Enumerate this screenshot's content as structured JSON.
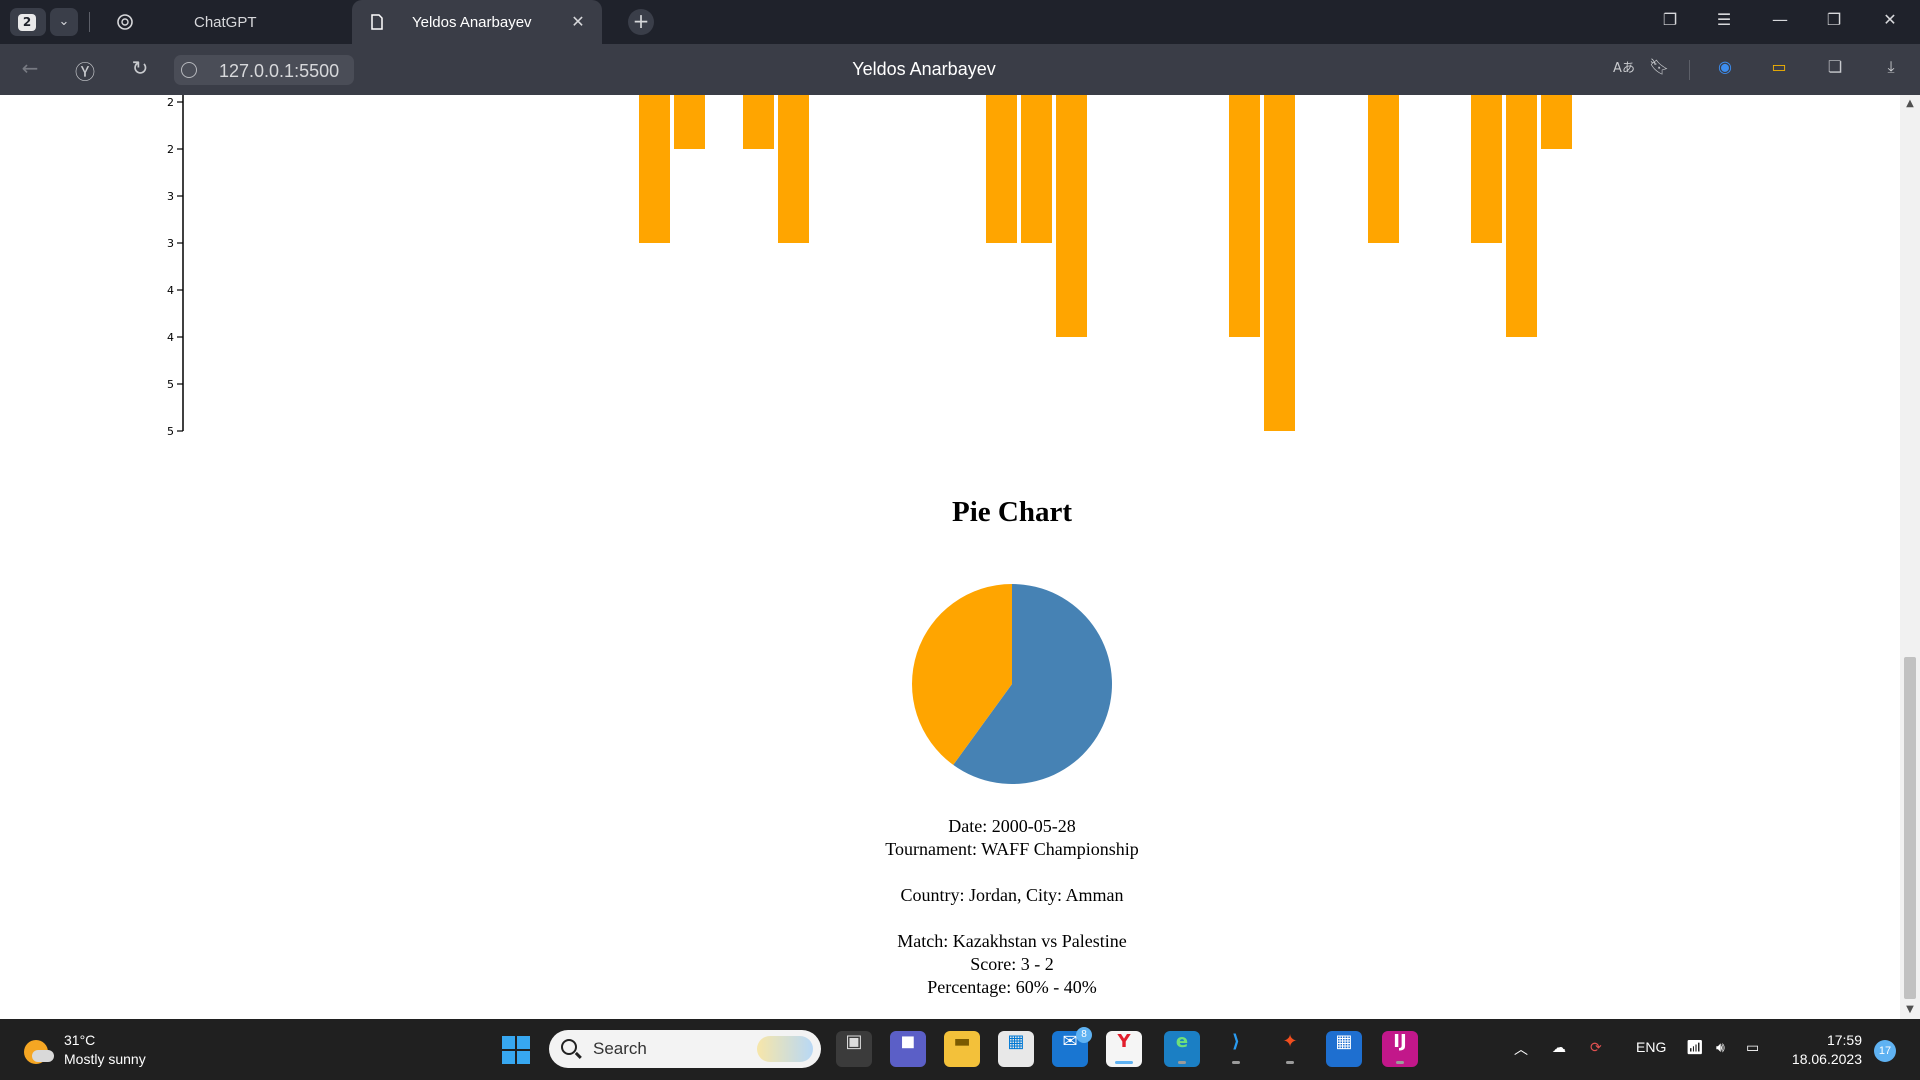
{
  "browser": {
    "tab_count": "2",
    "tabs": [
      {
        "label": "ChatGPT",
        "icon": "chatgpt-icon"
      },
      {
        "label": "Yeldos Anarbayev",
        "icon": "page-icon",
        "active": true
      }
    ],
    "url": "127.0.0.1:5500",
    "page_title": "Yeldos Anarbayev"
  },
  "page": {
    "pie_title": "Pie Chart",
    "match_info": {
      "date": "Date: 2000-05-28",
      "tournament": "Tournament: WAFF Championship",
      "location": "Country: Jordan, City: Amman",
      "match": "Match: Kazakhstan vs Palestine",
      "score": "Score: 3 - 2",
      "percentage": "Percentage: 60% - 40%"
    }
  },
  "chart_data": [
    {
      "type": "bar",
      "title": "",
      "xlabel": "",
      "ylabel": "",
      "y_tick_labels": [
        "2",
        "2",
        "3",
        "3",
        "4",
        "4",
        "5",
        "5"
      ],
      "ylim": [
        1.65,
        5.25
      ],
      "note_on_values": "bars hang from the top of the visible area; only the lower part of the chart is in view",
      "bar_color": "#ffa500",
      "values": [
        3,
        2,
        2,
        3,
        3,
        3,
        4,
        4,
        5,
        3,
        3,
        4,
        2
      ]
    },
    {
      "type": "pie",
      "slices": [
        {
          "value": 60,
          "color": "#4682b4"
        },
        {
          "value": 40,
          "color": "#ffa500"
        }
      ]
    }
  ],
  "taskbar": {
    "weather_temp": "31°C",
    "weather_desc": "Mostly sunny",
    "search_placeholder": "Search",
    "mail_badge": "8",
    "lang": "ENG",
    "time": "17:59",
    "date": "18.06.2023",
    "notifications": "17"
  }
}
